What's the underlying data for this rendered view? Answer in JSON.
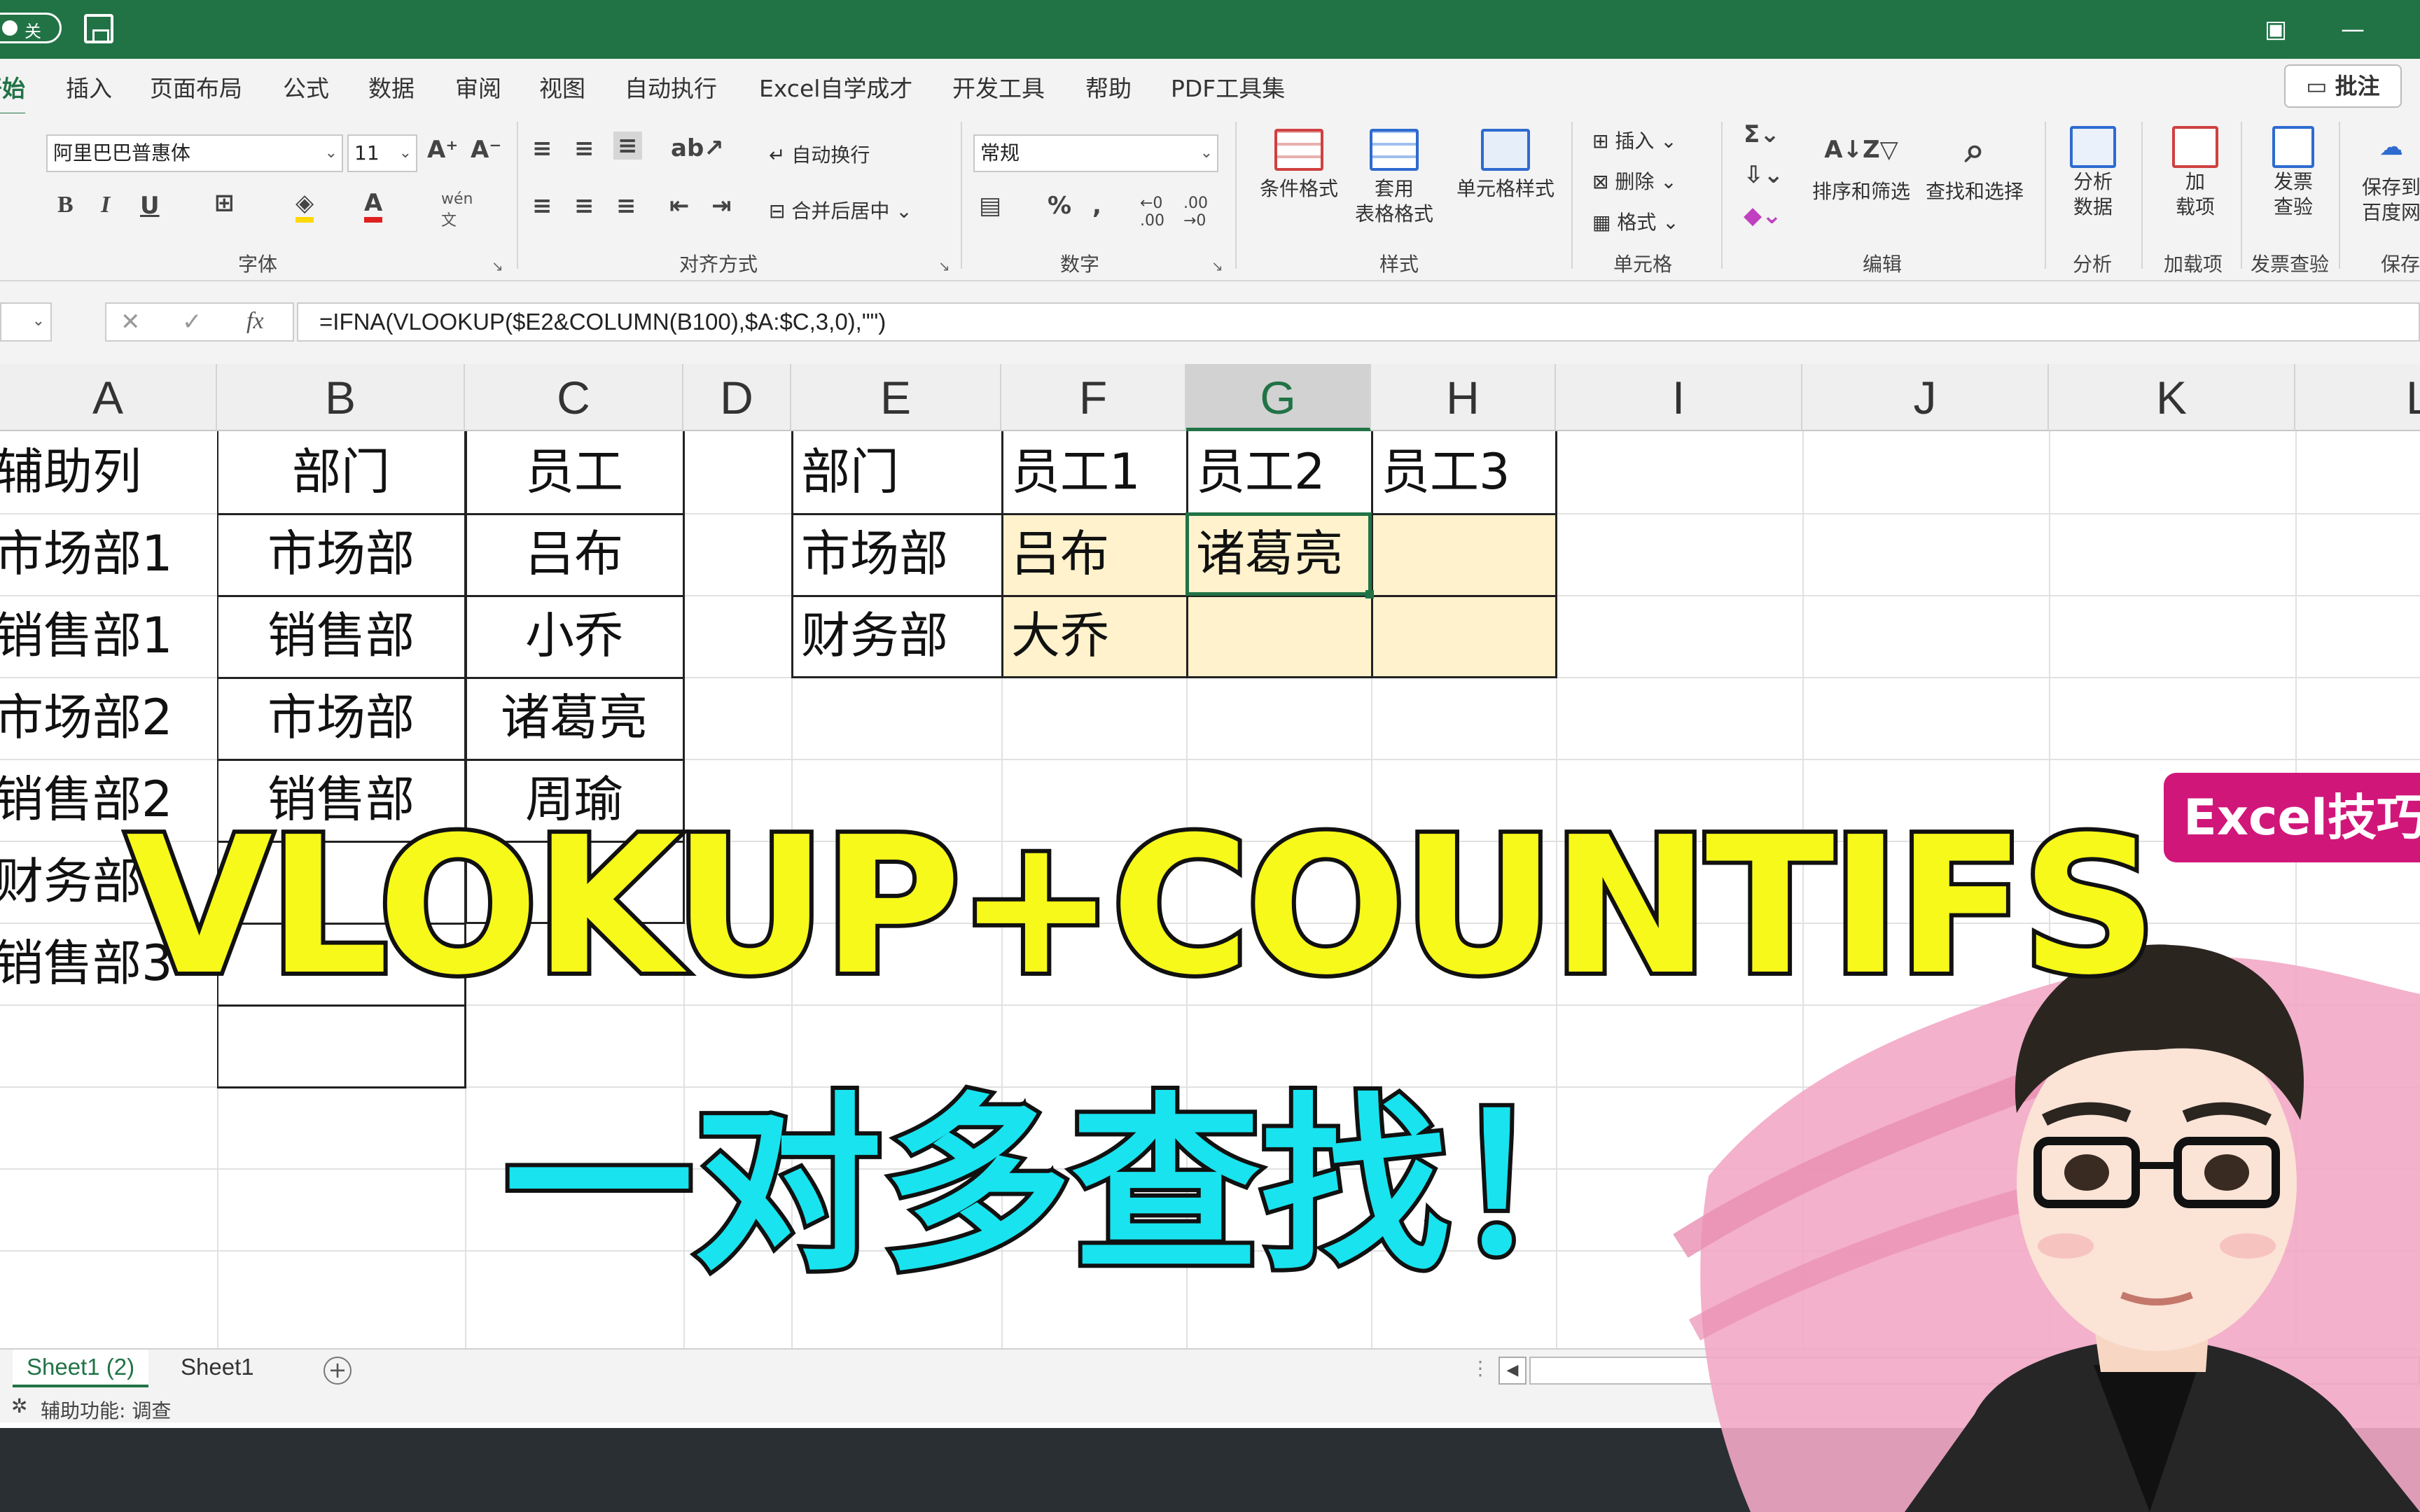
{
  "titlebar": {
    "autosave_label": "关"
  },
  "menu": {
    "tabs": [
      "开始",
      "插入",
      "页面布局",
      "公式",
      "数据",
      "审阅",
      "视图",
      "自动执行",
      "Excel自学成才",
      "开发工具",
      "帮助",
      "PDF工具集"
    ],
    "comment_button": "批注"
  },
  "ribbon": {
    "font_name": "阿里巴巴普惠体",
    "font_size": "11",
    "wrap_text": "自动换行",
    "merge_center": "合并后居中",
    "number_format": "常规",
    "cond_format": "条件格式",
    "table_format_1": "套用",
    "table_format_2": "表格格式",
    "cell_style": "单元格样式",
    "insert": "插入",
    "delete": "删除",
    "format": "格式",
    "sort_filter": "排序和筛选",
    "find_select": "查找和选择",
    "analyze_1": "分析",
    "analyze_2": "数据",
    "addin_1": "加",
    "addin_2": "载项",
    "invoice_1": "发票",
    "invoice_2": "查验",
    "save_1": "保存到",
    "save_2": "百度网",
    "groups": [
      "字体",
      "对齐方式",
      "数字",
      "样式",
      "单元格",
      "编辑",
      "分析",
      "加载项",
      "发票查验",
      "保存"
    ]
  },
  "formula": {
    "text": "=IFNA(VLOOKUP($E2&COLUMN(B100),$A:$C,3,0),\"\")"
  },
  "columns": [
    "A",
    "B",
    "C",
    "D",
    "E",
    "F",
    "G",
    "H",
    "I",
    "J",
    "K",
    "L"
  ],
  "source_table": {
    "rows": [
      [
        "辅助列",
        "部门",
        "员工"
      ],
      [
        "市场部1",
        "市场部",
        "吕布"
      ],
      [
        "销售部1",
        "销售部",
        "小乔"
      ],
      [
        "市场部2",
        "市场部",
        "诸葛亮"
      ],
      [
        "销售部2",
        "销售部",
        "周瑜"
      ],
      [
        "财务部",
        "",
        ""
      ],
      [
        "销售部3",
        "",
        ""
      ]
    ]
  },
  "result_table": {
    "header": [
      "部门",
      "员工1",
      "员工2",
      "员工3"
    ],
    "rows": [
      [
        "市场部",
        "吕布",
        "诸葛亮",
        ""
      ],
      [
        "财务部",
        "大乔",
        "",
        ""
      ]
    ]
  },
  "sheets": [
    "Sheet1 (2)",
    "Sheet1"
  ],
  "status": "辅助功能: 调查",
  "overlay": {
    "title": "VLOKUP+COUNTIFS",
    "subtitle": "一对多查找！",
    "badge": "Excel技巧"
  },
  "colors": {
    "excel_green": "#217346",
    "title_yellow": "#f6f91a",
    "subtitle_cyan": "#19e3ee",
    "badge_pink": "#d1167a"
  }
}
